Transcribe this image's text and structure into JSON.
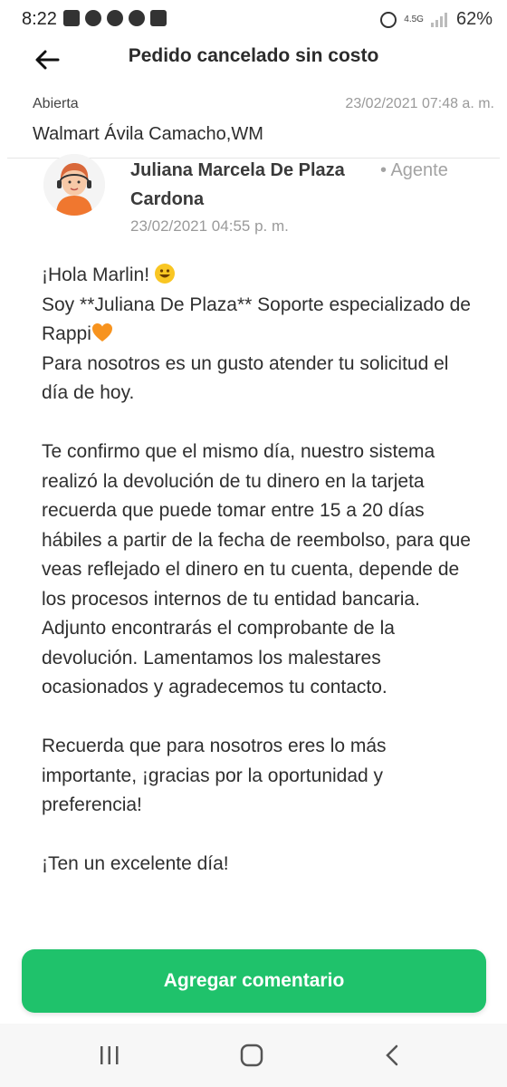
{
  "status_bar": {
    "time": "8:22",
    "battery": "62%",
    "network": "4.5G"
  },
  "header": {
    "title": "Pedido cancelado sin costo"
  },
  "order": {
    "status": "Abierta",
    "datetime": "23/02/2021 07:48 a. m.",
    "store": "Walmart Ávila Camacho,WM"
  },
  "message": {
    "agent_name": "Juliana Marcela De Plaza Cardona",
    "agent_role": "• Agente",
    "datetime": "23/02/2021 04:55 p. m.",
    "greeting": "¡Hola Marlin!",
    "intro_line": "Soy **Juliana De Plaza** Soporte especializado de Rappi",
    "line3": "Para nosotros es un gusto atender tu solicitud el día de hoy.",
    "paragraph2": "Te confirmo que el mismo día, nuestro sistema realizó la devolución de tu dinero en la tarjeta recuerda que puede tomar entre 15 a 20 días hábiles a partir de la fecha de reembolso, para que veas reflejado el dinero en tu cuenta, depende de los procesos internos de tu entidad bancaria. Adjunto encontrarás el comprobante de la devolución. Lamentamos los malestares ocasionados y agradecemos tu contacto.",
    "paragraph3": "Recuerda que para nosotros eres lo más importante, ¡gracias por la oportunidad y preferencia!",
    "closing": "¡Ten un excelente día!"
  },
  "actions": {
    "add_comment": "Agregar comentario"
  },
  "colors": {
    "accent": "#1fc26b",
    "avatar_bg": "#f28b5a"
  },
  "icons": {
    "back": "arrow-left-icon",
    "recents": "recents-icon",
    "home": "home-icon",
    "nav_back": "chevron-left-icon"
  }
}
